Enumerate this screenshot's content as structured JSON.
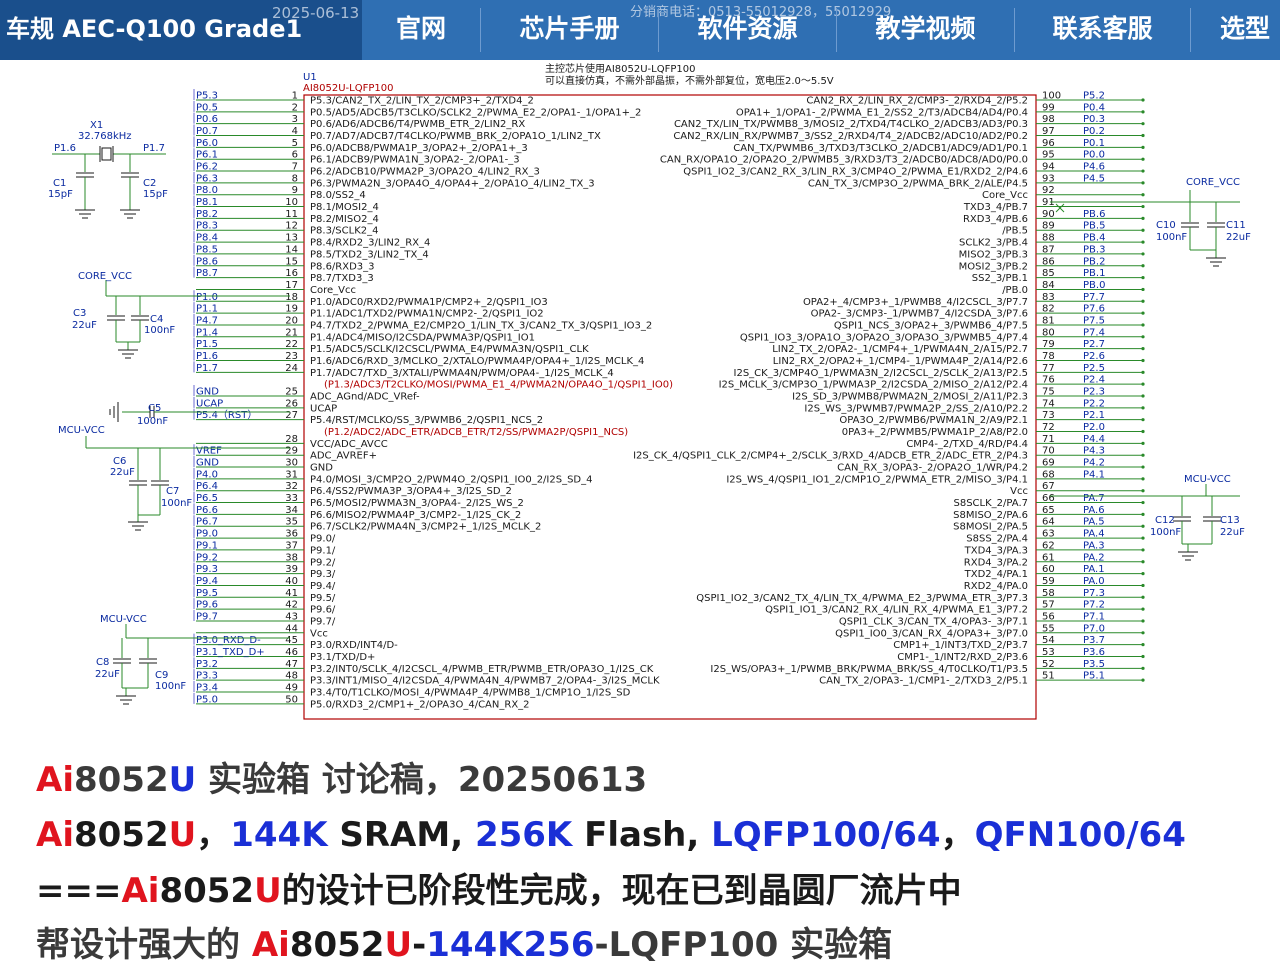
{
  "colors": {
    "nav_bg": "#2f6fb3",
    "nav_brand_bg": "#1a4f8c",
    "wire": "#2a8a2a",
    "chip_outline": "#b00000",
    "red": "#e0141e",
    "blue": "#1a2fd6"
  },
  "nav": {
    "brand": "车规 AEC-Q100 Grade1",
    "watermark_date": "2025-06-13",
    "watermark_phone": "分销商电话：0513-55012928，55012929",
    "items": [
      "官网",
      "芯片手册",
      "软件资源",
      "教学视频",
      "联系客服",
      "选型"
    ]
  },
  "schematic": {
    "ref": "U1",
    "part": "AI8052U-LQFP100",
    "note_line1": "主控芯片使用AI8052U-LQFP100",
    "note_line2": "可以直接仿真，不需外部晶振，不需外部复位，宽电压2.0～5.5V",
    "components": {
      "x1": "X1",
      "x1_val": "32.768kHz",
      "p16": "P1.6",
      "p17": "P1.7",
      "c1": "C1",
      "c1_val": "15pF",
      "c2": "C2",
      "c2_val": "15pF",
      "core_vcc_left": "CORE_VCC",
      "c3": "C3",
      "c3_val": "22uF",
      "c4": "C4",
      "c4_val": "100nF",
      "gnd_net": "GND",
      "ucap_net": "UCAP",
      "p54_net": "P5.4（RST）",
      "c5": "C5",
      "c5_val": "100nF",
      "mcu_vcc_1": "MCU-VCC",
      "c6": "C6",
      "c6_val": "22uF",
      "c7": "C7",
      "c7_val": "100nF",
      "mcu_vcc_2": "MCU-VCC",
      "c8": "C8",
      "c8_val": "22uF",
      "c9": "C9",
      "c9_val": "100nF",
      "core_vcc_right": "CORE_VCC",
      "c10": "C10",
      "c10_val": "100nF",
      "c11": "C11",
      "c11_val": "22uF",
      "mcu_vcc_right": "MCU-VCC",
      "c12": "C12",
      "c12_val": "100nF",
      "c13": "C13",
      "c13_val": "22uF"
    },
    "left_pins": [
      {
        "n": "1",
        "net": "P5.3",
        "label": "P5.3/CAN2_TX_2/LIN_TX_2/CMP3+_2/TXD4_2"
      },
      {
        "n": "2",
        "net": "P0.5",
        "label": "P0.5/AD5/ADCB5/T3CLKO/SCLK2_2/PWMA_E2_2/OPA1-_1/OPA1+_2"
      },
      {
        "n": "3",
        "net": "P0.6",
        "label": "P0.6/AD6/ADCB6/T4/PWMB_ETR_2/LIN2_RX"
      },
      {
        "n": "4",
        "net": "P0.7",
        "label": "P0.7/AD7/ADCB7/T4CLKO/PWMB_BRK_2/OPA1O_1/LIN2_TX"
      },
      {
        "n": "5",
        "net": "P6.0",
        "label": "P6.0/ADCB8/PWMA1P_3/OPA2+_2/OPA1+_3"
      },
      {
        "n": "6",
        "net": "P6.1",
        "label": "P6.1/ADCB9/PWMA1N_3/OPA2-_2/OPA1-_3"
      },
      {
        "n": "7",
        "net": "P6.2",
        "label": "P6.2/ADCB10/PWMA2P_3/OPA2O_4/LIN2_RX_3"
      },
      {
        "n": "8",
        "net": "P6.3",
        "label": "P6.3/PWMA2N_3/OPA4O_4/OPA4+_2/OPA1O_4/LIN2_TX_3"
      },
      {
        "n": "9",
        "net": "P8.0",
        "label": "P8.0/SS2_4"
      },
      {
        "n": "10",
        "net": "P8.1",
        "label": "P8.1/MOSI2_4"
      },
      {
        "n": "11",
        "net": "P8.2",
        "label": "P8.2/MISO2_4"
      },
      {
        "n": "12",
        "net": "P8.3",
        "label": "P8.3/SCLK2_4"
      },
      {
        "n": "13",
        "net": "P8.4",
        "label": "P8.4/RXD2_3/LIN2_RX_4"
      },
      {
        "n": "14",
        "net": "P8.5",
        "label": "P8.5/TXD2_3/LIN2_TX_4"
      },
      {
        "n": "15",
        "net": "P8.6",
        "label": "P8.6/RXD3_3"
      },
      {
        "n": "16",
        "net": "P8.7",
        "label": "P8.7/TXD3_3"
      },
      {
        "n": "17",
        "net": "",
        "label": "Core_Vcc"
      },
      {
        "n": "18",
        "net": "P1.0",
        "label": "P1.0/ADC0/RXD2/PWMA1P/CMP2+_2/QSPI1_IO3"
      },
      {
        "n": "19",
        "net": "P1.1",
        "label": "P1.1/ADC1/TXD2/PWMA1N/CMP2-_2/QSPI1_IO2"
      },
      {
        "n": "20",
        "net": "P4.7",
        "label": "P4.7/TXD2_2/PWMA_E2/CMP2O_1/LIN_TX_3/CAN2_TX_3/QSPI1_IO3_2"
      },
      {
        "n": "21",
        "net": "P1.4",
        "label": "P1.4/ADC4/MISO/I2CSDA/PWMA3P/QSPI1_IO1"
      },
      {
        "n": "22",
        "net": "P1.5",
        "label": "P1.5/ADC5/SCLK/I2CSCL/PWMA_E4/PWMA3N/QSPI1_CLK"
      },
      {
        "n": "23",
        "net": "P1.6",
        "label": "P1.6/ADC6/RXD_3/MCLKO_2/XTALO/PWMA4P/OPA4+_1/I2S_MCLK_4"
      },
      {
        "n": "24",
        "net": "P1.7",
        "label": "P1.7/ADC7/TXD_3/XTALI/PWMA4N/PWM/OPA4-_1/I2S_MCLK_4"
      },
      {
        "n": "",
        "net": "",
        "label": "(P1.3/ADC3/T2CLKO/MOSI/PWMA_E1_4/PWMA2N/OPA4O_1/QSPI1_IO0)",
        "red": true
      },
      {
        "n": "25",
        "net": "GND",
        "label": "ADC_AGnd/ADC_VRef-"
      },
      {
        "n": "26",
        "net": "UCAP",
        "label": "UCAP"
      },
      {
        "n": "27",
        "net": "P5.4（RST）",
        "label": "P5.4/RST/MCLKO/SS_3/PWMB6_2/QSPI1_NCS_2"
      },
      {
        "n": "",
        "net": "",
        "label": "(P1.2/ADC2/ADC_ETR/ADCB_ETR/T2/SS/PWMA2P/QSPI1_NCS)",
        "red": true
      },
      {
        "n": "28",
        "net": "",
        "label": "VCC/ADC_AVCC"
      },
      {
        "n": "29",
        "net": "VREF",
        "label": "ADC_AVREF+"
      },
      {
        "n": "30",
        "net": "GND",
        "label": "GND"
      },
      {
        "n": "31",
        "net": "P4.0",
        "label": "P4.0/MOSI_3/CMP2O_2/PWM4O_2/QSPI1_IO0_2/I2S_SD_4"
      },
      {
        "n": "32",
        "net": "P6.4",
        "label": "P6.4/SS2/PWMA3P_3/OPA4+_3/I2S_SD_2"
      },
      {
        "n": "33",
        "net": "P6.5",
        "label": "P6.5/MOSI2/PWMA3N_3/OPA4-_2/I2S_WS_2"
      },
      {
        "n": "34",
        "net": "P6.6",
        "label": "P6.6/MISO2/PWMA4P_3/CMP2-_1/I2S_CK_2"
      },
      {
        "n": "35",
        "net": "P6.7",
        "label": "P6.7/SCLK2/PWMA4N_3/CMP2+_1/I2S_MCLK_2"
      },
      {
        "n": "36",
        "net": "P9.0",
        "label": "P9.0/"
      },
      {
        "n": "37",
        "net": "P9.1",
        "label": "P9.1/"
      },
      {
        "n": "38",
        "net": "P9.2",
        "label": "P9.2/"
      },
      {
        "n": "39",
        "net": "P9.3",
        "label": "P9.3/"
      },
      {
        "n": "40",
        "net": "P9.4",
        "label": "P9.4/"
      },
      {
        "n": "41",
        "net": "P9.5",
        "label": "P9.5/"
      },
      {
        "n": "42",
        "net": "P9.6",
        "label": "P9.6/"
      },
      {
        "n": "43",
        "net": "P9.7",
        "label": "P9.7/"
      },
      {
        "n": "44",
        "net": "",
        "label": "Vcc"
      },
      {
        "n": "45",
        "net": "P3.0_RXD_D-",
        "label": "P3.0/RXD/INT4/D-"
      },
      {
        "n": "46",
        "net": "P3.1_TXD_D+",
        "label": "P3.1/TXD/D+"
      },
      {
        "n": "47",
        "net": "P3.2",
        "label": "P3.2/INT0/SCLK_4/I2CSCL_4/PWMB_ETR/PWMB_ETR/OPA3O_1/I2S_CK"
      },
      {
        "n": "48",
        "net": "P3.3",
        "label": "P3.3/INT1/MISO_4/I2CSDA_4/PWMA4N_4/PWMB7_2/OPA4-_3/I2S_MCLK"
      },
      {
        "n": "49",
        "net": "P3.4",
        "label": "P3.4/T0/T1CLKO/MOSI_4/PWMA4P_4/PWMB8_1/CMP1O_1/I2S_SD"
      },
      {
        "n": "50",
        "net": "P5.0",
        "label": "P5.0/RXD3_2/CMP1+_2/OPA3O_4/CAN_RX_2"
      }
    ],
    "right_pins": [
      {
        "n": "100",
        "net": "P5.2",
        "label": "CAN2_RX_2/LIN_RX_2/CMP3-_2/RXD4_2/P5.2"
      },
      {
        "n": "99",
        "net": "P0.4",
        "label": "OPA1+_1/OPA1-_2/PWMA_E1_2/SS2_2/T3/ADCB4/AD4/P0.4"
      },
      {
        "n": "98",
        "net": "P0.3",
        "label": "CAN2_TX/LIN_TX/PWMB8_3/MOSI2_2/TXD4/T4CLKO_2/ADCB3/AD3/P0.3"
      },
      {
        "n": "97",
        "net": "P0.2",
        "label": "CAN2_RX/LIN_RX/PWMB7_3/SS2_2/RXD4/T4_2/ADCB2/ADC10/AD2/P0.2"
      },
      {
        "n": "96",
        "net": "P0.1",
        "label": "CAN_TX/PWMB6_3/TXD3/T3CLKO_2/ADCB1/ADC9/AD1/P0.1"
      },
      {
        "n": "95",
        "net": "P0.0",
        "label": "CAN_RX/OPA1O_2/OPA2O_2/PWMB5_3/RXD3/T3_2/ADCB0/ADC8/AD0/P0.0"
      },
      {
        "n": "94",
        "net": "P4.6",
        "label": "QSPI1_IO2_3/CAN2_RX_3/LIN_RX_3/CMP4O_2/PWMA_E1/RXD2_2/P4.6"
      },
      {
        "n": "93",
        "net": "P4.5",
        "label": "CAN_TX_3/CMP3O_2/PWMA_BRK_2/ALE/P4.5"
      },
      {
        "n": "92",
        "net": "",
        "label": "Core_Vcc"
      },
      {
        "n": "91",
        "net": "",
        "label": "TXD3_4/PB.7"
      },
      {
        "n": "90",
        "net": "PB.6",
        "label": "RXD3_4/PB.6"
      },
      {
        "n": "89",
        "net": "PB.5",
        "label": "/PB.5"
      },
      {
        "n": "88",
        "net": "PB.4",
        "label": "SCLK2_3/PB.4"
      },
      {
        "n": "87",
        "net": "PB.3",
        "label": "MISO2_3/PB.3"
      },
      {
        "n": "86",
        "net": "PB.2",
        "label": "MOSI2_3/PB.2"
      },
      {
        "n": "85",
        "net": "PB.1",
        "label": "SS2_3/PB.1"
      },
      {
        "n": "84",
        "net": "PB.0",
        "label": "/PB.0"
      },
      {
        "n": "83",
        "net": "P7.7",
        "label": "OPA2+_4/CMP3+_1/PWMB8_4/I2CSCL_3/P7.7"
      },
      {
        "n": "82",
        "net": "P7.6",
        "label": "OPA2-_3/CMP3-_1/PWMB7_4/I2CSDA_3/P7.6"
      },
      {
        "n": "81",
        "net": "P7.5",
        "label": "QSPI1_NCS_3/OPA2+_3/PWMB6_4/P7.5"
      },
      {
        "n": "80",
        "net": "P7.4",
        "label": "QSPI1_IO3_3/OPA1O_3/OPA2O_3/OPA3O_3/PWMB5_4/P7.4"
      },
      {
        "n": "79",
        "net": "P2.7",
        "label": "LIN2_TX_2/OPA2-_1/CMP4+_1/PWMA4N_2/A15/P2.7"
      },
      {
        "n": "78",
        "net": "P2.6",
        "label": "LIN2_RX_2/OPA2+_1/CMP4-_1/PWMA4P_2/A14/P2.6"
      },
      {
        "n": "77",
        "net": "P2.5",
        "label": "I2S_CK_3/CMP4O_1/PWMA3N_2/I2CSCL_2/SCLK_2/A13/P2.5"
      },
      {
        "n": "76",
        "net": "P2.4",
        "label": "I2S_MCLK_3/CMP3O_1/PWMA3P_2/I2CSDA_2/MISO_2/A12/P2.4"
      },
      {
        "n": "75",
        "net": "P2.3",
        "label": "I2S_SD_3/PWMB8/PWMA2N_2/MOSI_2/A11/P2.3"
      },
      {
        "n": "74",
        "net": "P2.2",
        "label": "I2S_WS_3/PWMB7/PWMA2P_2/SS_2/A10/P2.2"
      },
      {
        "n": "73",
        "net": "P2.1",
        "label": "OPA3O_2/PWMB6/PWMA1N_2/A9/P2.1"
      },
      {
        "n": "72",
        "net": "P2.0",
        "label": "0PA3+_2/PWMB5/PWMA1P_2/A8/P2.0"
      },
      {
        "n": "71",
        "net": "P4.4",
        "label": "CMP4-_2/TXD_4/RD/P4.4"
      },
      {
        "n": "70",
        "net": "P4.3",
        "label": "I2S_CK_4/QSPI1_CLK_2/CMP4+_2/SCLK_3/RXD_4/ADCB_ETR_2/ADC_ETR_2/P4.3"
      },
      {
        "n": "69",
        "net": "P4.2",
        "label": "CAN_RX_3/OPA3-_2/OPA2O_1/WR/P4.2"
      },
      {
        "n": "68",
        "net": "P4.1",
        "label": "I2S_WS_4/QSPI1_IO1_2/CMP1O_2/PWMA_ETR_2/MISO_3/P4.1"
      },
      {
        "n": "67",
        "net": "",
        "label": "Vcc"
      },
      {
        "n": "66",
        "net": "PA.7",
        "label": "S8SCLK_2/PA.7"
      },
      {
        "n": "65",
        "net": "PA.6",
        "label": "S8MISO_2/PA.6"
      },
      {
        "n": "64",
        "net": "PA.5",
        "label": "S8MOSI_2/PA.5"
      },
      {
        "n": "63",
        "net": "PA.4",
        "label": "S8SS_2/PA.4"
      },
      {
        "n": "62",
        "net": "PA.3",
        "label": "TXD4_3/PA.3"
      },
      {
        "n": "61",
        "net": "PA.2",
        "label": "RXD4_3/PA.2"
      },
      {
        "n": "60",
        "net": "PA.1",
        "label": "TXD2_4/PA.1"
      },
      {
        "n": "59",
        "net": "PA.0",
        "label": "RXD2_4/PA.0"
      },
      {
        "n": "58",
        "net": "P7.3",
        "label": "QSPI1_IO2_3/CAN2_TX_4/LIN_TX_4/PWMA_E2_3/PWMA_ETR_3/P7.3"
      },
      {
        "n": "57",
        "net": "P7.2",
        "label": "QSPI1_IO1_3/CAN2_RX_4/LIN_RX_4/PWMA_E1_3/P7.2"
      },
      {
        "n": "56",
        "net": "P7.1",
        "label": "QSPI1_CLK_3/CAN_TX_4/OPA3-_3/P7.1"
      },
      {
        "n": "55",
        "net": "P7.0",
        "label": "QSPI1_IO0_3/CAN_RX_4/OPA3+_3/P7.0"
      },
      {
        "n": "54",
        "net": "P3.7",
        "label": "CMP1+_1/INT3/TXD_2/P3.7"
      },
      {
        "n": "53",
        "net": "P3.6",
        "label": "CMP1-_1/INT2/RXD_2/P3.6"
      },
      {
        "n": "52",
        "net": "P3.5",
        "label": "I2S_WS/OPA3+_1/PWMB_BRK/PWMA_BRK/SS_4/T0CLKO/T1/P3.5"
      },
      {
        "n": "51",
        "net": "P5.1",
        "label": "CAN_TX_2/OPA3-_1/CMP1-_2/TXD3_2/P5.1"
      }
    ]
  },
  "captions": {
    "line1": {
      "p1": "Ai",
      "p2": "8052",
      "p3": "U",
      "p4": " 实验箱 讨论稿，20250613"
    },
    "line2": {
      "p1": "Ai",
      "p2": "8052",
      "p3": "U",
      "p4": "，",
      "p5": "144K",
      "p6": " SRAM, ",
      "p7": "256K",
      "p8": " Flash, ",
      "p9": "LQFP100/64",
      "p10": "，",
      "p11": "QFN100/64"
    },
    "line3": {
      "p1": "===",
      "p2": "Ai",
      "p3": "8052",
      "p4": "U",
      "p5": "的设计已阶段性完成，现在已到晶圆厂流片中"
    },
    "line4": {
      "p1": "帮设计强大的 ",
      "p2": "Ai",
      "p3": "8052",
      "p4": "U",
      "p5": "-",
      "p6": "144K256",
      "p7": "-LQFP100 实验箱"
    }
  }
}
